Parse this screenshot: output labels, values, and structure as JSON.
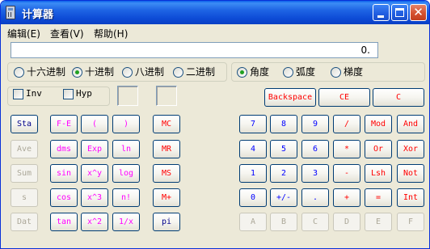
{
  "window": {
    "title": "计算器"
  },
  "menu": [
    {
      "label": "编辑(E)"
    },
    {
      "label": "查看(V)"
    },
    {
      "label": "帮助(H)"
    }
  ],
  "display": {
    "value": "0."
  },
  "base_options": [
    {
      "label": "十六进制",
      "selected": false
    },
    {
      "label": "十进制",
      "selected": true
    },
    {
      "label": "八进制",
      "selected": false
    },
    {
      "label": "二进制",
      "selected": false
    }
  ],
  "angle_options": [
    {
      "label": "角度",
      "selected": true
    },
    {
      "label": "弧度",
      "selected": false
    },
    {
      "label": "梯度",
      "selected": false
    }
  ],
  "checkboxes": {
    "inv": "Inv",
    "hyp": "Hyp"
  },
  "top_buttons": {
    "backspace": "Backspace",
    "ce": "CE",
    "c": "C"
  },
  "sci_left": [
    "Sta",
    "Ave",
    "Sum",
    "s",
    "Dat"
  ],
  "sci_col1": [
    "F-E",
    "dms",
    "sin",
    "cos",
    "tan"
  ],
  "sci_col2": [
    "(",
    "Exp",
    "x^y",
    "x^3",
    "x^2"
  ],
  "sci_col3": [
    ")",
    "ln",
    "log",
    "n!",
    "1/x"
  ],
  "mem": [
    "MC",
    "MR",
    "MS",
    "M+",
    "pi"
  ],
  "pad": [
    [
      "7",
      "8",
      "9",
      "/",
      "Mod",
      "And"
    ],
    [
      "4",
      "5",
      "6",
      "*",
      "Or",
      "Xor"
    ],
    [
      "1",
      "2",
      "3",
      "-",
      "Lsh",
      "Not"
    ],
    [
      "0",
      "+/-",
      ".",
      "+",
      "=",
      "Int"
    ],
    [
      "A",
      "B",
      "C",
      "D",
      "E",
      "F"
    ]
  ],
  "colors": {
    "title_bar": "#0A4FD6",
    "window_bg": "#ECE9D8",
    "digit_text": "#0000FF",
    "operator_text": "#FF0000",
    "function_text": "#FF00FF",
    "disabled_text": "#ACA899"
  }
}
